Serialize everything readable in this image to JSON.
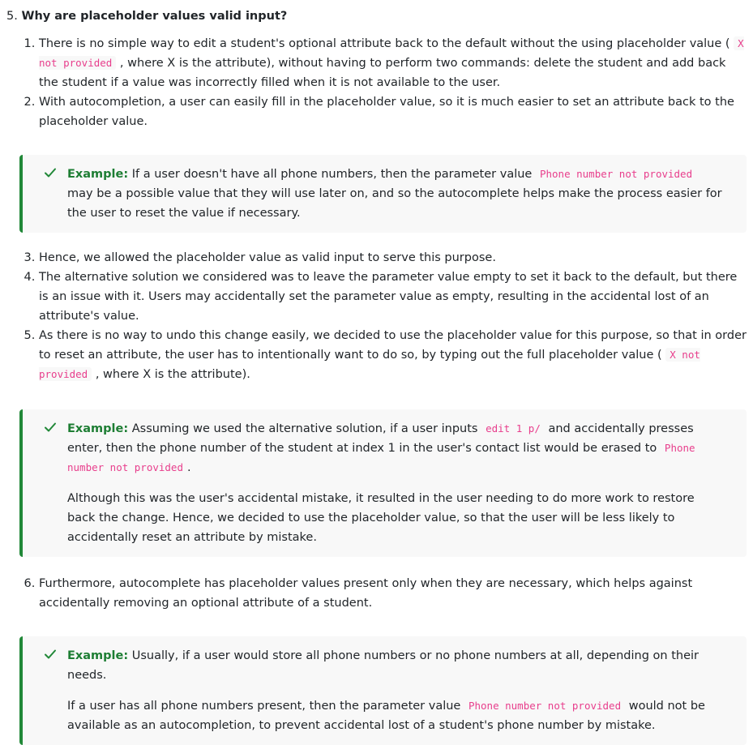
{
  "question": {
    "number": "5.",
    "title": "Why are placeholder values valid input?"
  },
  "list_a": [
    {
      "text_1": "There is no simple way to edit a student's optional attribute back to the default without the using placeholder value (",
      "code_1": "X not provided",
      "text_2": ", where X is the attribute), without having to perform two commands: delete the student and add back the student if a value was incorrectly filled when it is not available to the user."
    },
    {
      "text_1": "With autocompletion, a user can easily fill in the placeholder value, so it is much easier to set an attribute back to the placeholder value."
    }
  ],
  "callout_1": {
    "label": "Example:",
    "text_1": "If a user doesn't have all phone numbers, then the parameter value",
    "code_1": "Phone number not provided",
    "text_2": "may be a possible value that they will use later on, and so the autocomplete helps make the process easier for the user to reset the value if necessary."
  },
  "list_b": [
    {
      "text_1": "Hence, we allowed the placeholder value as valid input to serve this purpose."
    },
    {
      "text_1": "The alternative solution we considered was to leave the parameter value empty to set it back to the default, but there is an issue with it. Users may accidentally set the parameter value as empty, resulting in the accidental lost of an attribute's value."
    },
    {
      "text_1": "As there is no way to undo this change easily, we decided to use the placeholder value for this purpose, so that in order to reset an attribute, the user has to intentionally want to do so, by typing out the full placeholder value (",
      "code_1": "X not provided",
      "text_2": ", where X is the attribute)."
    }
  ],
  "callout_2": {
    "label": "Example:",
    "text_1": "Assuming we used the alternative solution, if a user inputs",
    "code_1": "edit 1 p/",
    "text_2": "and accidentally presses enter, then the phone number of the student at index 1 in the user's contact list would be erased to",
    "code_2": "Phone number not provided",
    "text_3": ".",
    "para_2": "Although this was the user's accidental mistake, it resulted in the user needing to do more work to restore back the change. Hence, we decided to use the placeholder value, so that the user will be less likely to accidentally reset an attribute by mistake."
  },
  "list_c": [
    {
      "text_1": "Furthermore, autocomplete has placeholder values present only when they are necessary, which helps against accidentally removing an optional attribute of a student."
    }
  ],
  "callout_3": {
    "label": "Example:",
    "text_1": "Usually, if a user would store all phone numbers or no phone numbers at all, depending on their needs.",
    "para_2_text_1": "If a user has all phone numbers present, then the parameter value",
    "para_2_code_1": "Phone number not provided",
    "para_2_text_2": "would not be available as an autocompletion, to prevent accidental lost of a student's phone number by mistake."
  },
  "colors": {
    "accent_green": "#218838",
    "label_green": "#1e7e34",
    "code_pink": "#e83e8c",
    "callout_bg": "#f8f8f8"
  },
  "icons": {
    "callout": "check-icon"
  }
}
